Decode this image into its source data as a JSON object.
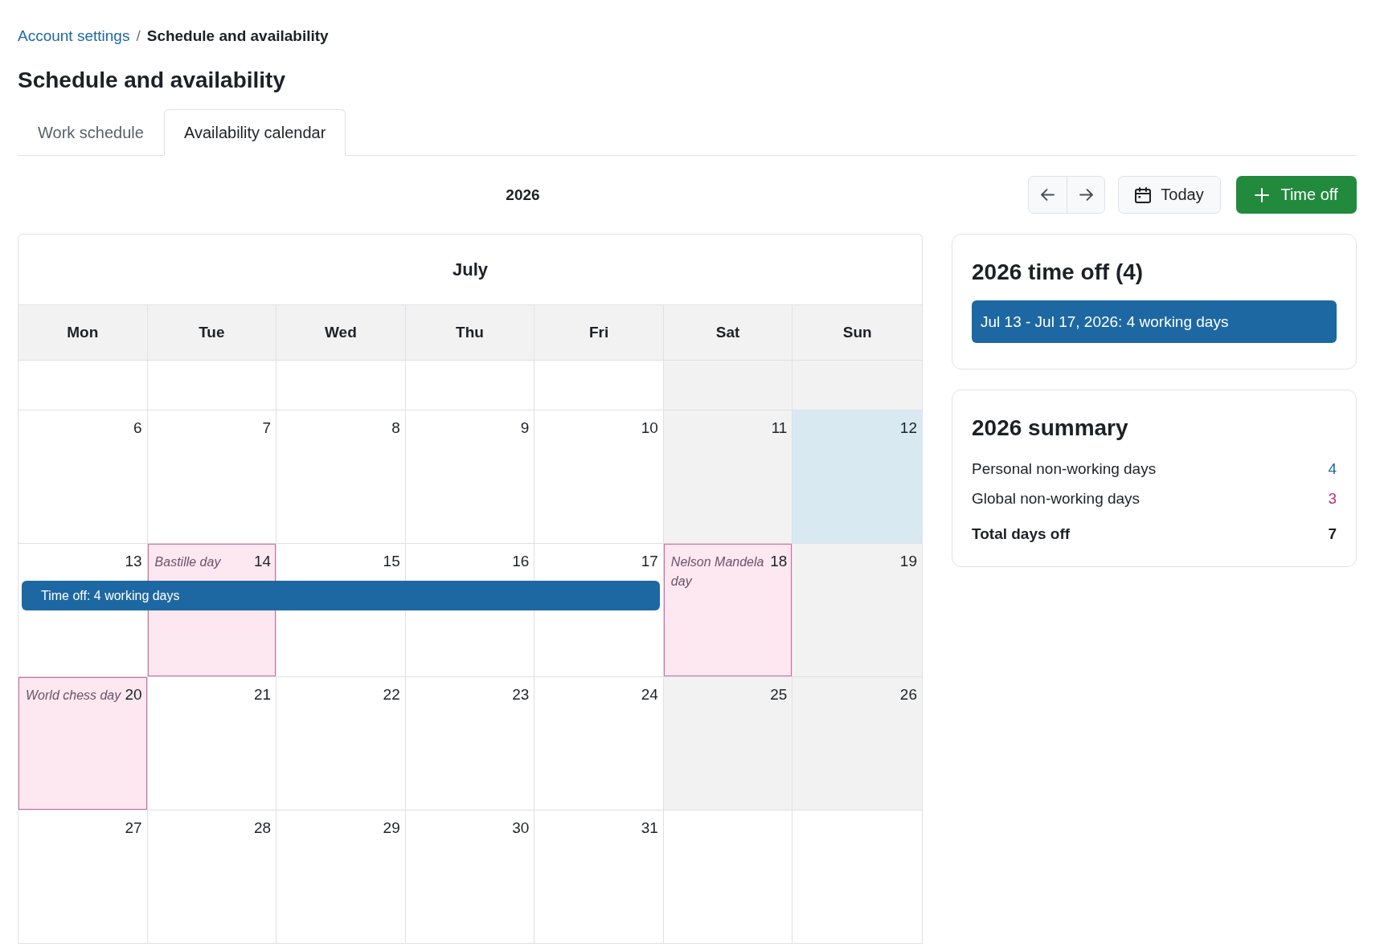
{
  "breadcrumb": {
    "items": [
      {
        "label": "Account settings",
        "kind": "link"
      },
      {
        "label": "Schedule and availability",
        "kind": "current"
      }
    ],
    "separator": "/"
  },
  "title": "Schedule and availability",
  "tabs": [
    {
      "label": "Work schedule",
      "selected": false
    },
    {
      "label": "Availability calendar",
      "selected": true
    }
  ],
  "toolbar": {
    "year": "2026",
    "today_button": "Today",
    "add_button": "Time off"
  },
  "calendar": {
    "month": "July",
    "weekdays": [
      "Mon",
      "Tue",
      "Wed",
      "Thu",
      "Fri",
      "Sat",
      "Sun"
    ],
    "weeks": [
      {
        "days": [
          {
            "kind": "workday",
            "time_off": false
          },
          {
            "kind": "workday",
            "time_off": false
          },
          {
            "kind": "workday",
            "time_off": false
          },
          {
            "kind": "workday",
            "time_off": false
          },
          {
            "kind": "workday",
            "time_off": false
          },
          {
            "kind": "weekend",
            "time_off": false
          },
          {
            "kind": "weekend",
            "time_off": false
          }
        ]
      },
      {
        "days": [
          {
            "number": "6",
            "kind": "workday",
            "time_off": false
          },
          {
            "number": "7",
            "kind": "workday",
            "time_off": false
          },
          {
            "number": "8",
            "kind": "workday",
            "time_off": false
          },
          {
            "number": "9",
            "kind": "workday",
            "time_off": false
          },
          {
            "number": "10",
            "kind": "workday",
            "time_off": false
          },
          {
            "number": "11",
            "kind": "weekend",
            "time_off": false
          },
          {
            "number": "12",
            "kind": "today",
            "time_off": false
          }
        ]
      },
      {
        "time_off_label": "Time off: 4 working days",
        "days": [
          {
            "number": "13",
            "kind": "workday",
            "time_off": true
          },
          {
            "number": "14",
            "kind": "holiday",
            "holiday": "Bastille day",
            "time_off": true
          },
          {
            "number": "15",
            "kind": "workday",
            "time_off": true
          },
          {
            "number": "16",
            "kind": "workday",
            "time_off": true
          },
          {
            "number": "17",
            "kind": "workday",
            "time_off": true
          },
          {
            "number": "18",
            "kind": "holiday",
            "holiday": "Nelson Mandela day",
            "time_off": false
          },
          {
            "number": "19",
            "kind": "weekend",
            "time_off": false
          }
        ]
      },
      {
        "days": [
          {
            "number": "20",
            "kind": "holiday",
            "holiday": "World chess day",
            "time_off": false
          },
          {
            "number": "21",
            "kind": "workday",
            "time_off": false
          },
          {
            "number": "22",
            "kind": "workday",
            "time_off": false
          },
          {
            "number": "23",
            "kind": "workday",
            "time_off": false
          },
          {
            "number": "24",
            "kind": "workday",
            "time_off": false
          },
          {
            "number": "25",
            "kind": "weekend",
            "time_off": false
          },
          {
            "number": "26",
            "kind": "weekend",
            "time_off": false
          }
        ]
      },
      {
        "days": [
          {
            "number": "27",
            "kind": "workday",
            "time_off": false
          },
          {
            "number": "28",
            "kind": "workday",
            "time_off": false
          },
          {
            "number": "29",
            "kind": "workday",
            "time_off": false
          },
          {
            "number": "30",
            "kind": "workday",
            "time_off": false
          },
          {
            "number": "31",
            "kind": "workday",
            "time_off": false
          },
          {
            "kind": "blank",
            "time_off": false
          },
          {
            "kind": "blank",
            "time_off": false
          }
        ]
      }
    ]
  },
  "time_off_card": {
    "title": "2026 time off (4)",
    "entries": [
      "Jul 13 - Jul 17, 2026: 4 working days"
    ]
  },
  "summary_card": {
    "title": "2026 summary",
    "rows": [
      {
        "label": "Personal non-working days",
        "value": "4",
        "color": "#1d68a3",
        "kind": "item"
      },
      {
        "label": "Global non-working days",
        "value": "3",
        "color": "#c02c7c",
        "kind": "item"
      },
      {
        "label": "Total days off",
        "value": "7",
        "color": "#1d2125",
        "kind": "total"
      }
    ]
  }
}
